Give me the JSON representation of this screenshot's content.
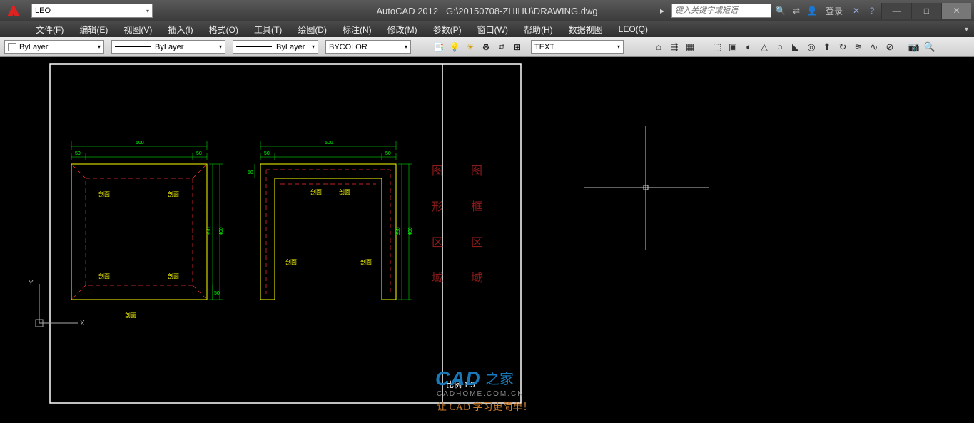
{
  "title": {
    "app": "AutoCAD 2012",
    "file": "G:\\20150708-ZHIHU\\DRAWING.dwg"
  },
  "workspace": {
    "current": "LEO"
  },
  "search": {
    "placeholder": "键入关键字或短语"
  },
  "login": {
    "label": "登录"
  },
  "menus": [
    "文件(F)",
    "编辑(E)",
    "视图(V)",
    "插入(I)",
    "格式(O)",
    "工具(T)",
    "绘图(D)",
    "标注(N)",
    "修改(M)",
    "参数(P)",
    "窗口(W)",
    "帮助(H)",
    "数据视图",
    "LEO(Q)"
  ],
  "props": {
    "color_label": "ByLayer",
    "linetype_label": "ByLayer",
    "lineweight_label": "ByLayer",
    "plotstyle_label": "BYCOLOR",
    "text_style": "TEXT"
  },
  "drawing": {
    "dim_top_full": "500",
    "dim_top_seg_l": "50",
    "dim_top_seg_r": "50",
    "dim_side_full": "400",
    "dim_side_seg": "350",
    "dim_small": "50",
    "hatch_tag": "剖面",
    "vtext_left": [
      "图",
      "形",
      "区",
      "域"
    ],
    "vtext_right": [
      "图",
      "框",
      "区",
      "域"
    ],
    "scale_label": "比例   1:5",
    "ucs_x": "X",
    "ucs_y": "Y"
  },
  "watermark": {
    "brand1": "CAD",
    "brand2": "之家",
    "url": "CADHOME.COM.CN",
    "slogan": "让 CAD 学习更简单！"
  }
}
